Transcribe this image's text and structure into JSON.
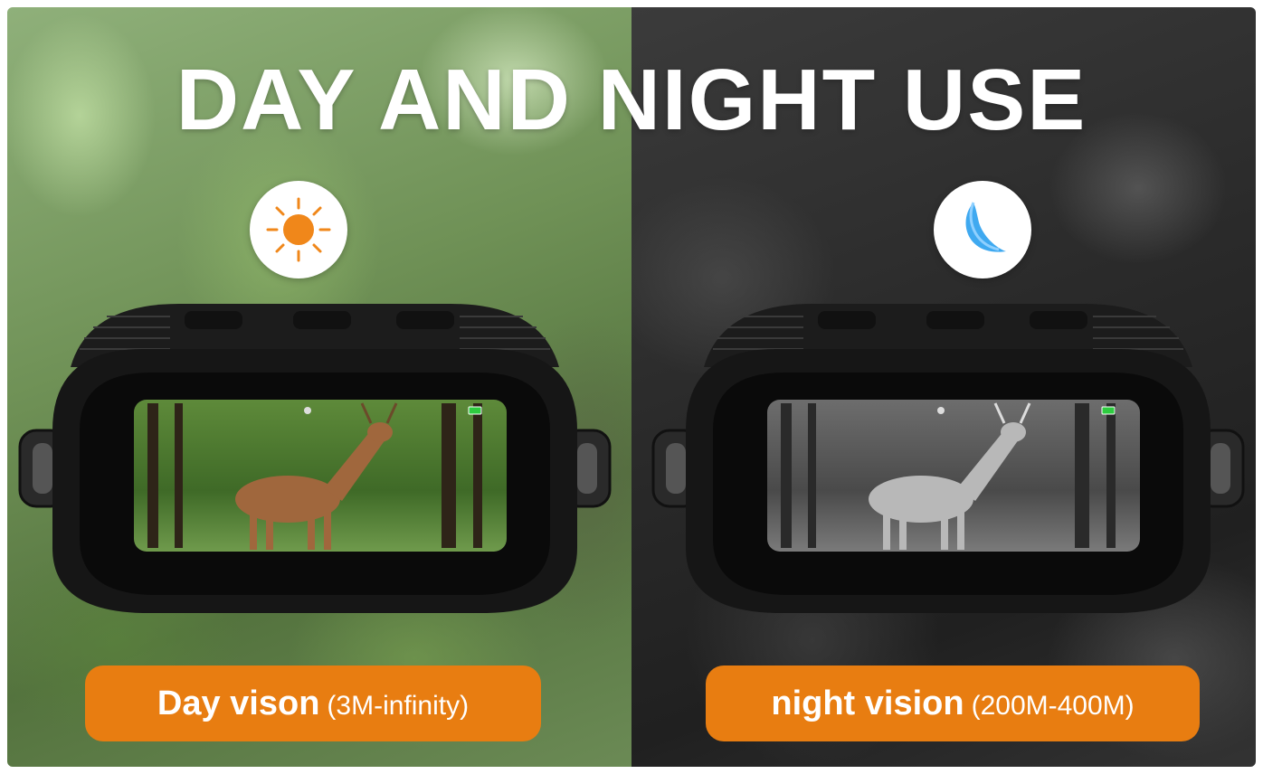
{
  "headline": "DAY AND NIGHT USE",
  "day_panel": {
    "icon": "sun-icon",
    "label": "Day vison",
    "range": "(3M-infinity)",
    "screen_style": "color"
  },
  "night_panel": {
    "icon": "moon-icon",
    "label": "night vision",
    "range": "(200M-400M)",
    "screen_style": "monochrome"
  },
  "colors": {
    "label_background": "#e87d11",
    "sun": "#f0871a",
    "moon": "#3fa9f0",
    "battery": "#2ecc40"
  }
}
